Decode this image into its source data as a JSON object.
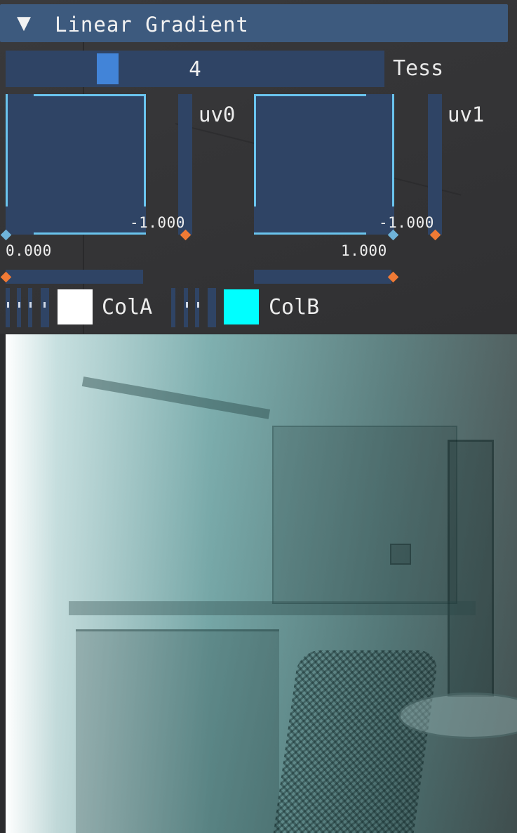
{
  "header": {
    "toggle_icon": "triangle-down-icon",
    "title": "Linear Gradient"
  },
  "tess": {
    "value": "4",
    "label": "Tess",
    "value_fraction": 0.28
  },
  "uv0": {
    "label": "uv0",
    "min_value": "-1.000",
    "x_value": "0.000"
  },
  "uv1": {
    "label": "uv1",
    "min_value": "-1.000",
    "x_value": "1.000"
  },
  "colors": {
    "colA": {
      "label": "ColA",
      "hex": "#ffffff"
    },
    "colB": {
      "label": "ColB",
      "hex": "#00ffff"
    },
    "accent": "#4284d8",
    "handle": "#f07a35"
  },
  "preview": {
    "description_icon": "gradient-preview"
  }
}
